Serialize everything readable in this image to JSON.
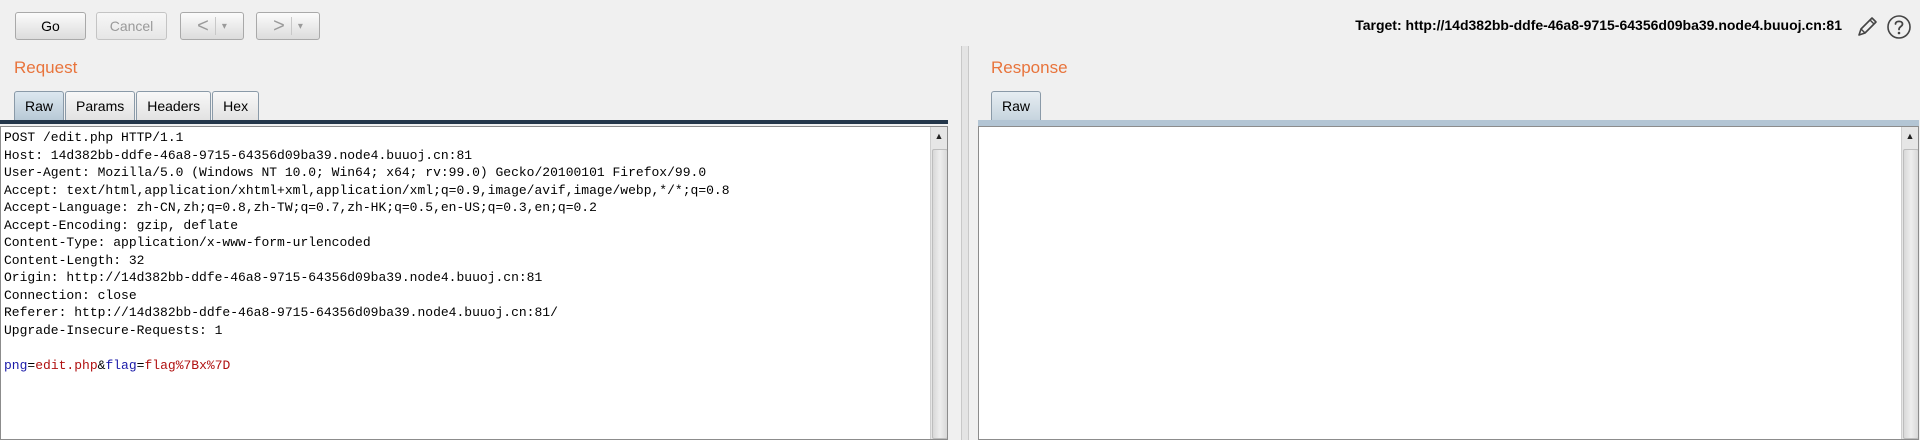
{
  "toolbar": {
    "go_label": "Go",
    "cancel_label": "Cancel",
    "back_arrow": "<",
    "forward_arrow": ">",
    "dropdown_caret": "▾",
    "target_text": "Target: http://14d382bb-ddfe-46a8-9715-64356d09ba39.node4.buuoj.cn:81"
  },
  "request": {
    "title": "Request",
    "tabs": [
      "Raw",
      "Params",
      "Headers",
      "Hex"
    ],
    "active_tab": "Raw",
    "lines": [
      "POST /edit.php HTTP/1.1",
      "Host: 14d382bb-ddfe-46a8-9715-64356d09ba39.node4.buuoj.cn:81",
      "User-Agent: Mozilla/5.0 (Windows NT 10.0; Win64; x64; rv:99.0) Gecko/20100101 Firefox/99.0",
      "Accept: text/html,application/xhtml+xml,application/xml;q=0.9,image/avif,image/webp,*/*;q=0.8",
      "Accept-Language: zh-CN,zh;q=0.8,zh-TW;q=0.7,zh-HK;q=0.5,en-US;q=0.3,en;q=0.2",
      "Accept-Encoding: gzip, deflate",
      "Content-Type: application/x-www-form-urlencoded",
      "Content-Length: 32",
      "Origin: http://14d382bb-ddfe-46a8-9715-64356d09ba39.node4.buuoj.cn:81",
      "Connection: close",
      "Referer: http://14d382bb-ddfe-46a8-9715-64356d09ba39.node4.buuoj.cn:81/",
      "Upgrade-Insecure-Requests: 1"
    ],
    "body": {
      "param1_name": "png",
      "eq": "=",
      "param1_value": "edit.php",
      "amp": "&",
      "param2_name": "flag",
      "param2_value": "flag%7Bx%7D"
    }
  },
  "response": {
    "title": "Response",
    "tabs": [
      "Raw"
    ],
    "active_tab": "Raw"
  },
  "colors": {
    "pane_title": "#e8743c",
    "param_name": "#1a1aa8",
    "param_value": "#b01010"
  }
}
